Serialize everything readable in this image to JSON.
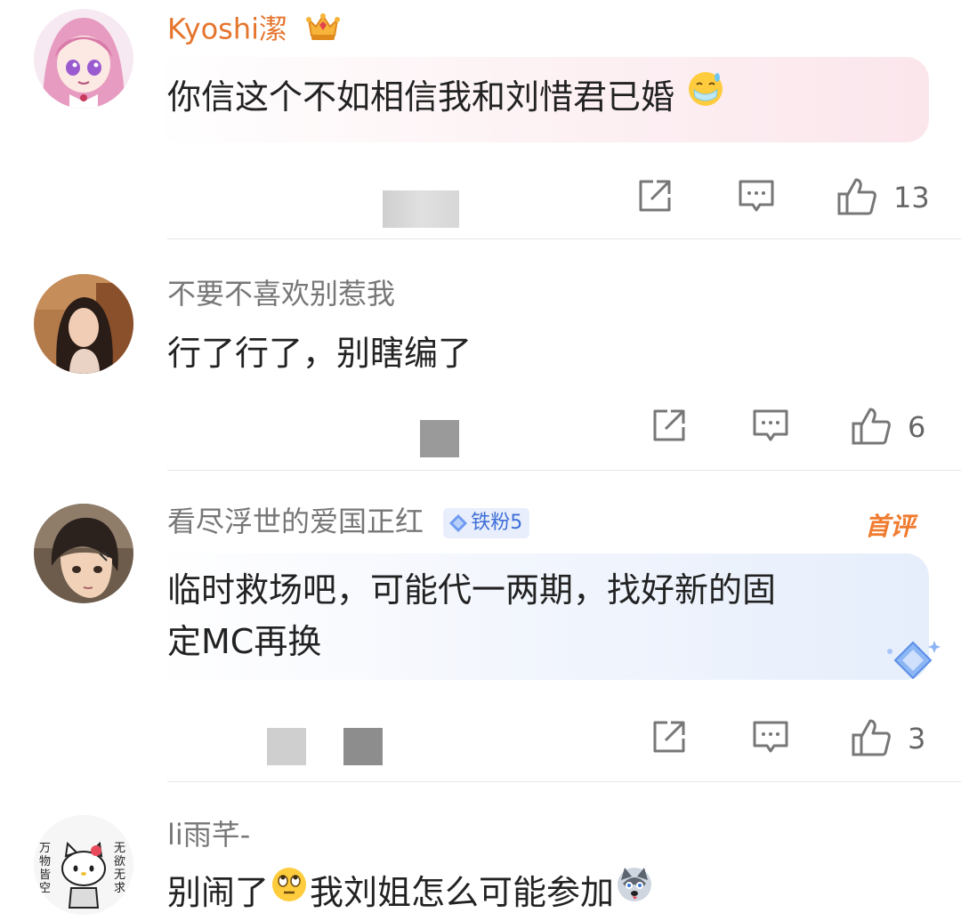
{
  "comments": [
    {
      "username": "Kyoshi潔",
      "avatar_icon": "anime-pink-hair-avatar",
      "badge_icon": "crown-badge-icon",
      "text": "你信这个不如相信我和刘惜君已婚",
      "trailing_emoji": "sweat-smile-mask-emoji",
      "like_count": "13",
      "bubble": "pink"
    },
    {
      "username": "不要不喜欢别惹我",
      "avatar_icon": "photo-avatar",
      "text": "行了行了，别瞎编了",
      "like_count": "6"
    },
    {
      "username": "看尽浮世的爱国正红",
      "avatar_icon": "anime-boy-avatar",
      "fan_badge": "铁粉5",
      "first_tag": "首评",
      "text_line1": "临时救场吧，可能代一两期，找好新的固",
      "text_line2": "定MC再换",
      "like_count": "3",
      "bubble": "blue"
    },
    {
      "username": "li雨芊-",
      "avatar_icon": "hello-kitty-avatar",
      "avatar_text_left": "万物皆空",
      "avatar_text_right": "无欲无求",
      "text_part1": "别闹了",
      "emoji1": "eye-roll-emoji",
      "text_part2": "我刘姐怎么可能参加",
      "emoji2": "husky-emoji"
    }
  ],
  "icons": {
    "share": "share-icon",
    "comment": "comment-icon",
    "like": "thumbs-up-icon"
  },
  "colors": {
    "vip_name": "#e5742d",
    "normal_name": "#777777",
    "text": "#222222",
    "fan_badge": "#3e6fd8",
    "first_tag": "#f07b2f"
  }
}
